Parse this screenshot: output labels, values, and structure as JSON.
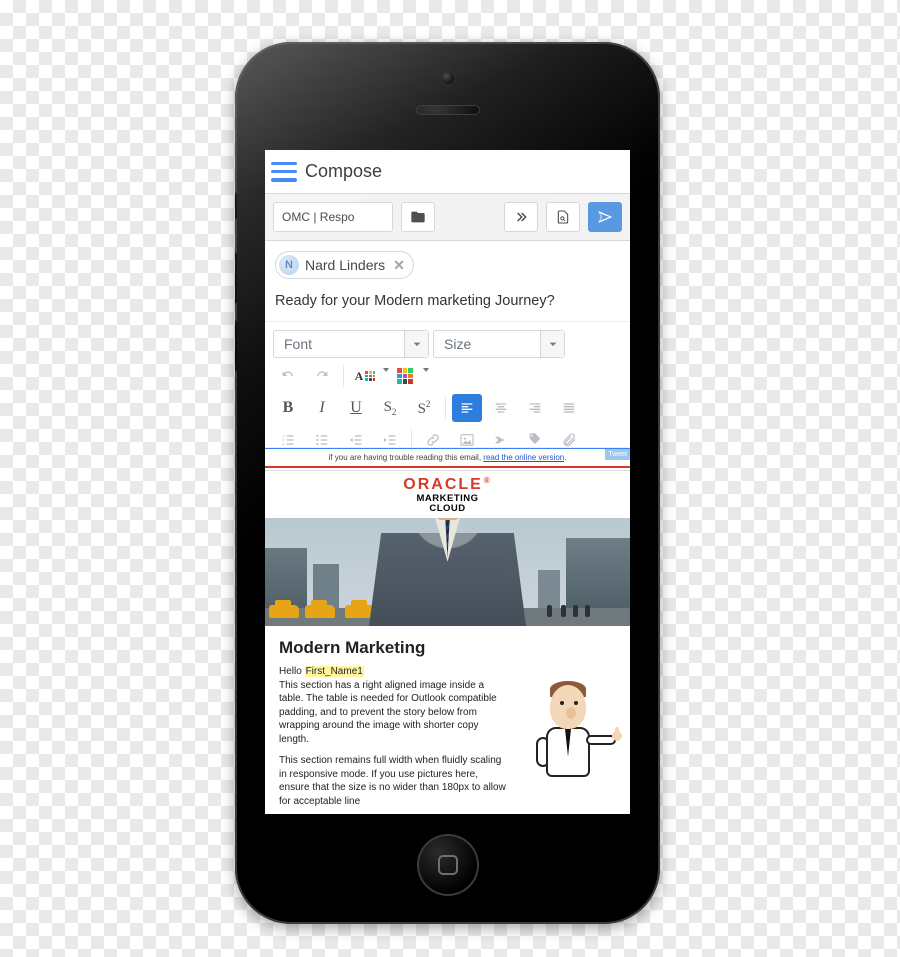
{
  "colors": {
    "primary_blue": "#3b82f6",
    "send_blue": "#5899e2",
    "brand_red": "#d73a28",
    "highlight_yellow": "#fff59d"
  },
  "header": {
    "title": "Compose"
  },
  "actionbar": {
    "subject_truncated": "OMC | Respo"
  },
  "recipient": {
    "initial": "N",
    "name": "Nard Linders"
  },
  "subject": {
    "text": "Ready for your Modern marketing Journey?"
  },
  "toolbar": {
    "font_label": "Font",
    "size_label": "Size"
  },
  "preview": {
    "trouble_prefix": "if you are having trouble reading this email, ",
    "trouble_link": "read the online version",
    "flag": "Tweet",
    "logo_brand": "ORACLE",
    "logo_sub1": "MARKETING",
    "logo_sub2": "CLOUD",
    "heading": "Modern Marketing",
    "hello_prefix": "Hello ",
    "hello_placeholder": "First_Name1",
    "para1": "This section has a right aligned image inside a table. The table is needed for Outlook compatible padding, and to prevent the story below from wrapping around the image with shorter copy length.",
    "para2": "This section remains full width when fluidly scaling in responsive mode. If you use pictures here, ensure that the size is no wider than 180px to allow for acceptable line"
  }
}
